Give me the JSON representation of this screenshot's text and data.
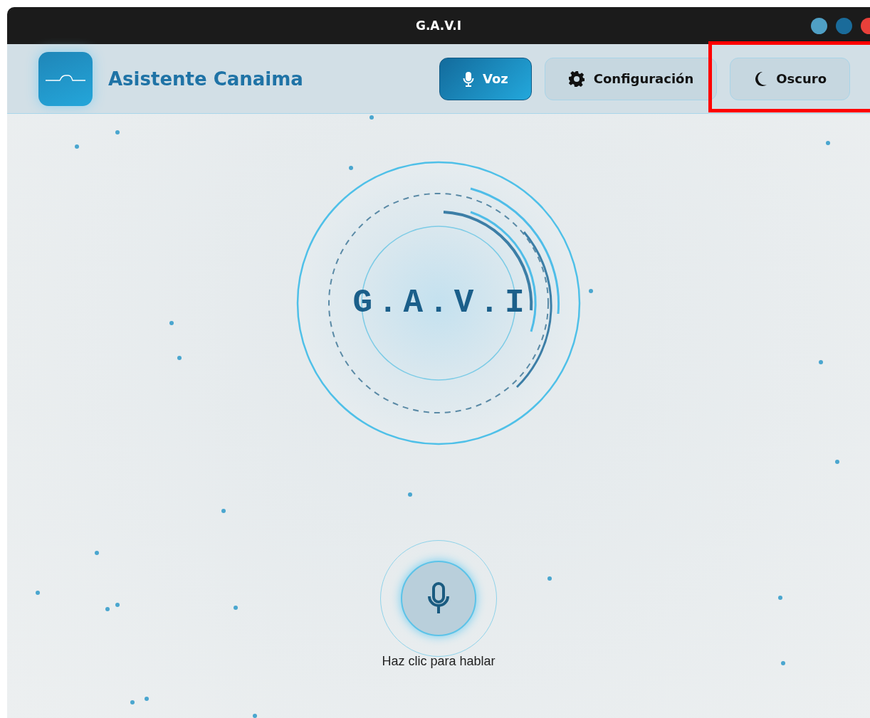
{
  "window": {
    "title": "G.A.V.I"
  },
  "header": {
    "app_name": "Asistente Canaima",
    "nav": [
      {
        "kind": "voice",
        "label": "Voz",
        "selected": true
      },
      {
        "kind": "settings",
        "label": "Configuración",
        "selected": false
      },
      {
        "kind": "theme",
        "label": "Oscuro",
        "selected": false
      }
    ]
  },
  "hero": {
    "logo_text": "G.A.V.I"
  },
  "voice": {
    "hint": "Haz clic para hablar"
  }
}
